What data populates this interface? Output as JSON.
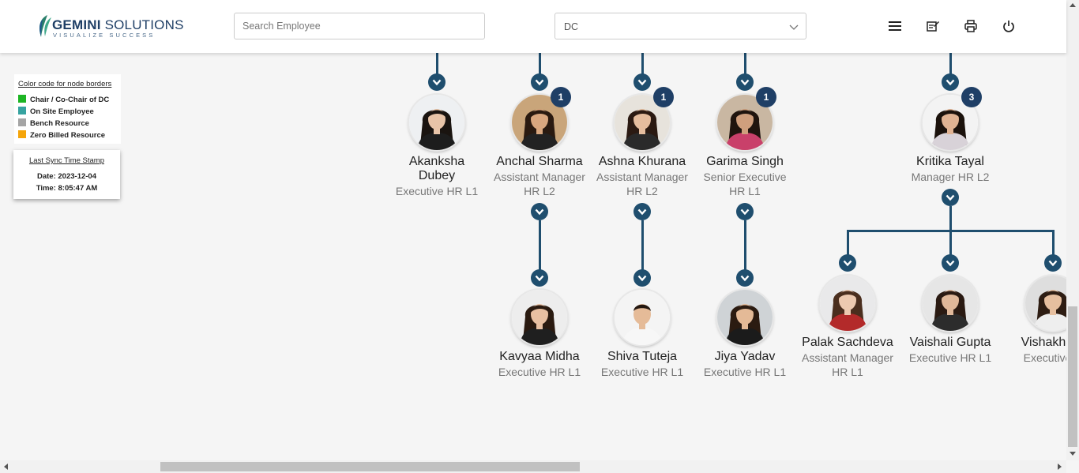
{
  "header": {
    "brand_name_bold": "GEMINI",
    "brand_name_rest": " SOLUTIONS",
    "brand_tagline": "VISUALIZE SUCCESS",
    "search_placeholder": "Search Employee",
    "dc_select_value": "DC",
    "icons": [
      "menu-icon",
      "edit-note-icon",
      "print-icon",
      "power-icon"
    ]
  },
  "legend": {
    "title": "Color code for node borders",
    "items": [
      {
        "label": "Chair / Co-Chair of DC",
        "color": "#1db524"
      },
      {
        "label": "On Site Employee",
        "color": "#36a3a0"
      },
      {
        "label": "Bench Resource",
        "color": "#a5a5a5"
      },
      {
        "label": "Zero Billed Resource",
        "color": "#f5a50a"
      }
    ]
  },
  "sync": {
    "title": "Last Sync Time Stamp",
    "date": "Date: 2023-12-04",
    "time": "Time: 8:05:47 AM"
  },
  "colors": {
    "connector": "#1f4e6e",
    "badge": "#1f3f66"
  },
  "nodes": [
    {
      "name_lines": [
        "Akanksha",
        "Dubey"
      ],
      "role_lines": [
        "Executive HR L1"
      ],
      "badge": ""
    },
    {
      "name_lines": [
        "Anchal Sharma"
      ],
      "role_lines": [
        "Assistant Manager",
        "HR L2"
      ],
      "badge": "1"
    },
    {
      "name_lines": [
        "Ashna Khurana"
      ],
      "role_lines": [
        "Assistant Manager",
        "HR L2"
      ],
      "badge": "1"
    },
    {
      "name_lines": [
        "Garima Singh"
      ],
      "role_lines": [
        "Senior Executive",
        "HR L1"
      ],
      "badge": "1"
    },
    {
      "name_lines": [
        "Kritika Tayal"
      ],
      "role_lines": [
        "Manager HR L2"
      ],
      "badge": "3"
    },
    {
      "name_lines": [
        "Kavyaa Midha"
      ],
      "role_lines": [
        "Executive HR L1"
      ],
      "badge": ""
    },
    {
      "name_lines": [
        "Shiva Tuteja"
      ],
      "role_lines": [
        "Executive HR L1"
      ],
      "badge": ""
    },
    {
      "name_lines": [
        "Jiya Yadav"
      ],
      "role_lines": [
        "Executive HR L1"
      ],
      "badge": ""
    },
    {
      "name_lines": [
        "Palak Sachdeva"
      ],
      "role_lines": [
        "Assistant Manager",
        "HR L1"
      ],
      "badge": ""
    },
    {
      "name_lines": [
        "Vaishali Gupta"
      ],
      "role_lines": [
        "Executive HR L1"
      ],
      "badge": ""
    },
    {
      "name_lines": [
        "Vishakha S"
      ],
      "role_lines": [
        "Executive H"
      ],
      "badge": ""
    }
  ]
}
